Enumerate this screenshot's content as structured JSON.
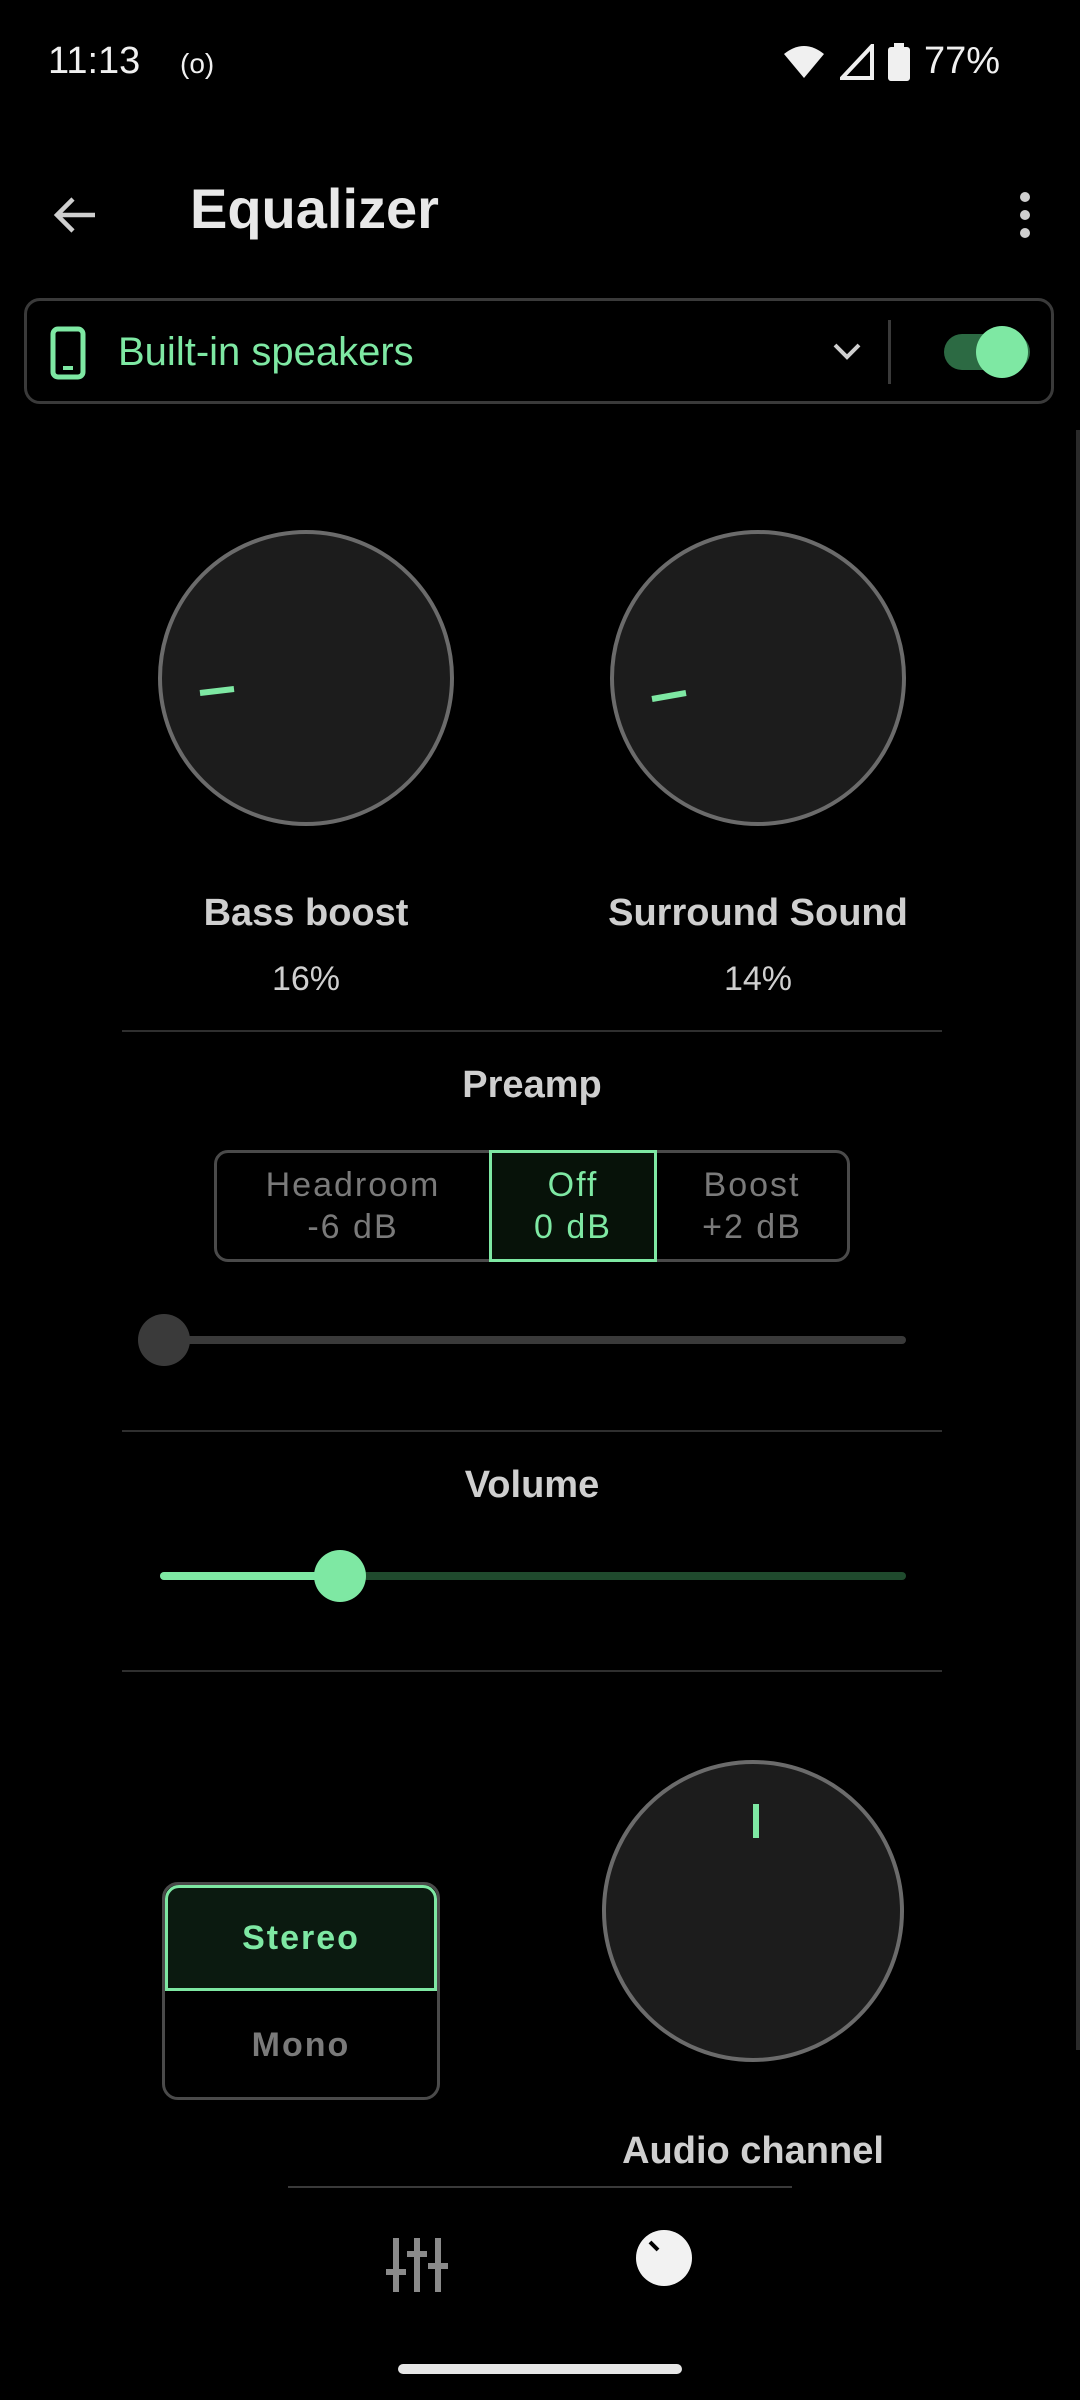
{
  "status_bar": {
    "time": "11:13",
    "radio_icon_text": "(o)",
    "battery_percent": "77%"
  },
  "app_bar": {
    "title": "Equalizer"
  },
  "device": {
    "name": "Built-in speakers",
    "enabled": true
  },
  "effects": {
    "bass_boost": {
      "label": "Bass boost",
      "value": "16%"
    },
    "surround": {
      "label": "Surround Sound",
      "value": "14%"
    }
  },
  "preamp": {
    "title": "Preamp",
    "options": [
      {
        "line1": "Headroom",
        "line2": "-6 dB"
      },
      {
        "line1": "Off",
        "line2": "0 dB"
      },
      {
        "line1": "Boost",
        "line2": "+2 dB"
      }
    ],
    "selected_index": 1,
    "slider_fraction": 0.0
  },
  "volume": {
    "title": "Volume",
    "slider_fraction": 0.24
  },
  "channel": {
    "stereo_label": "Stereo",
    "mono_label": "Mono",
    "selected": "Stereo",
    "knob_label": "Audio channel"
  },
  "colors": {
    "accent": "#7ee8a3",
    "background": "#000000",
    "knob_fill": "#1c1c1c"
  }
}
